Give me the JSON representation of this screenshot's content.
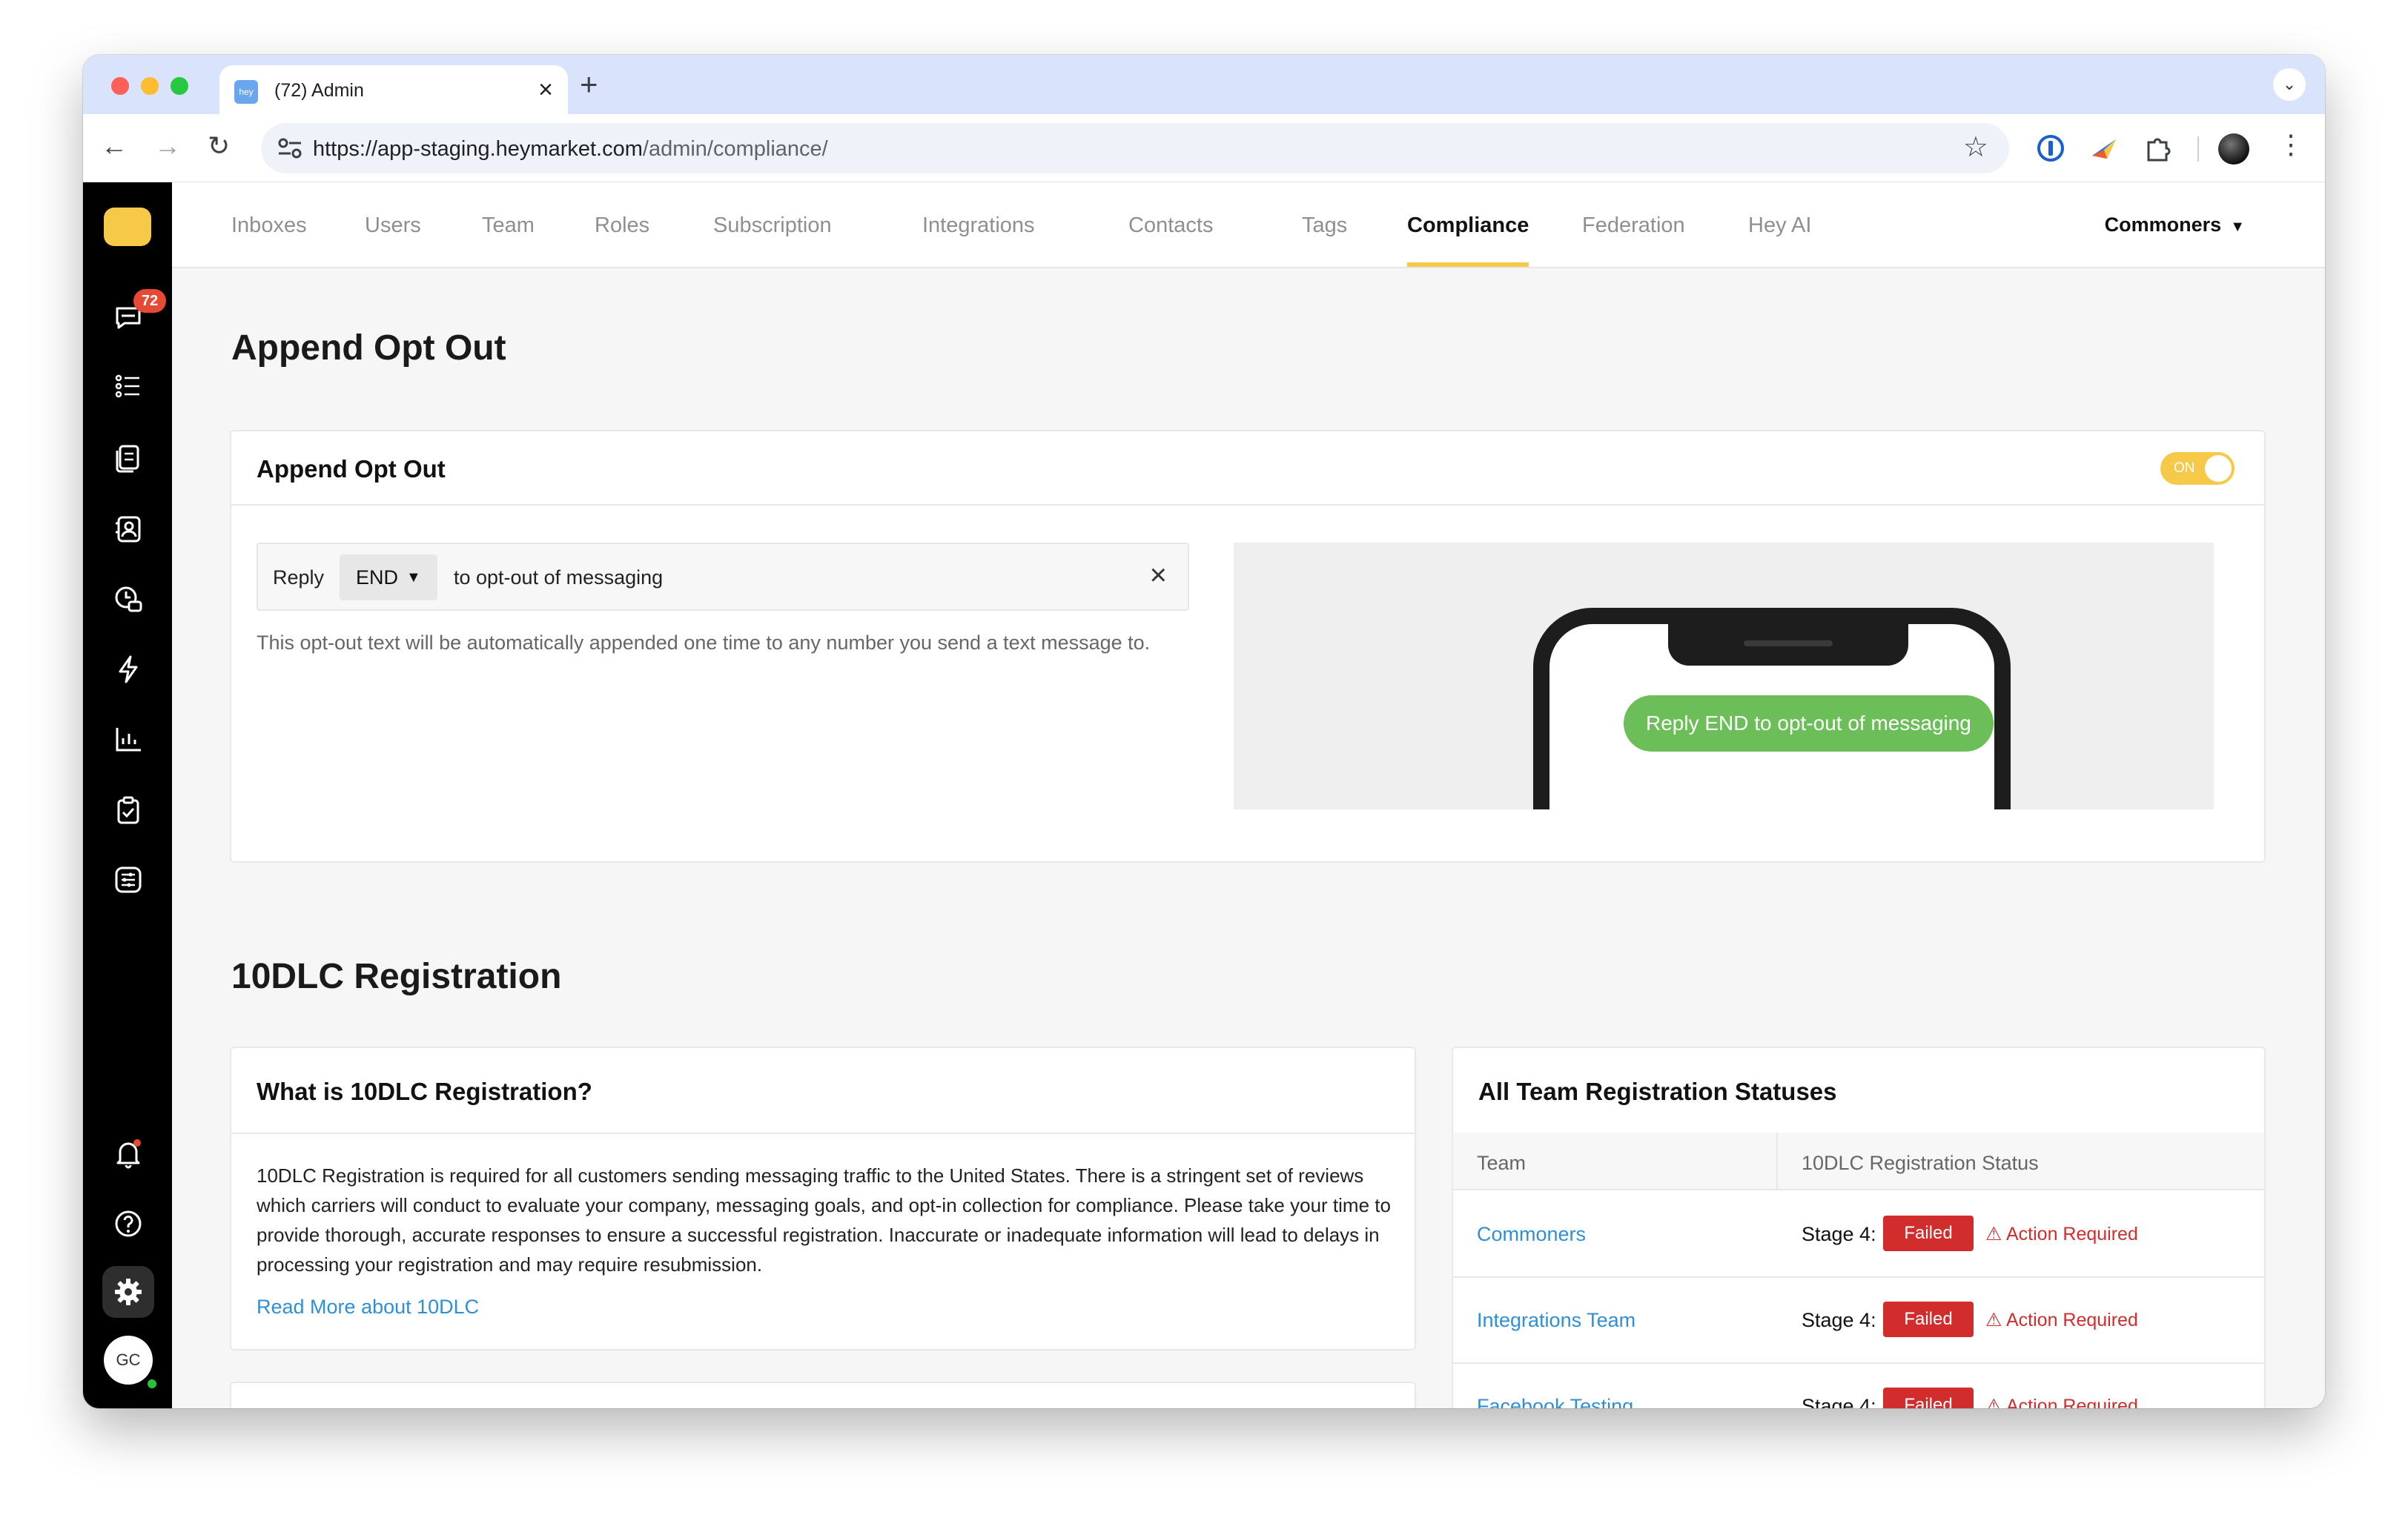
{
  "browser": {
    "tab_title": "(72) Admin",
    "favicon_text": "hey",
    "url_host": "https://app-staging.heymarket.com",
    "url_path": "/admin/compliance/"
  },
  "sidebar": {
    "unread_badge": "72",
    "avatar_initials": "GC"
  },
  "topnav": {
    "items": [
      "Inboxes",
      "Users",
      "Team",
      "Roles",
      "Subscription",
      "Integrations",
      "Contacts",
      "Tags",
      "Compliance",
      "Federation",
      "Hey AI"
    ],
    "active": "Compliance",
    "account": "Commoners"
  },
  "append_opt_out": {
    "heading": "Append Opt Out",
    "card_title": "Append Opt Out",
    "toggle_label": "ON",
    "reply_label": "Reply",
    "keyword": "END",
    "suffix": "to opt-out of messaging",
    "help_text": "This opt-out text will be automatically appended one time to any number you send a text message to.",
    "preview_message": "Reply END to opt-out of messaging"
  },
  "registration": {
    "heading": "10DLC Registration",
    "info_title": "What is 10DLC Registration?",
    "info_text": "10DLC Registration is required for all customers sending messaging traffic to the United States. There is a stringent set of reviews which carriers will conduct to evaluate your company, messaging goals, and opt-in collection for compliance. Please take your time to provide thorough, accurate responses to ensure a successful registration. Inaccurate or inadequate information will lead to delays in processing your registration and may require resubmission.",
    "read_more": "Read More about 10DLC",
    "status_title": "All Team Registration Statuses",
    "columns": [
      "Team",
      "10DLC Registration Status"
    ],
    "rows": [
      {
        "team": "Commoners",
        "stage": "Stage 4:",
        "status": "Failed",
        "warning": "Action Required"
      },
      {
        "team": "Integrations Team",
        "stage": "Stage 4:",
        "status": "Failed",
        "warning": "Action Required"
      },
      {
        "team": "Facebook Testing",
        "stage": "Stage 4:",
        "status": "Failed",
        "warning": "Action Required"
      }
    ]
  }
}
